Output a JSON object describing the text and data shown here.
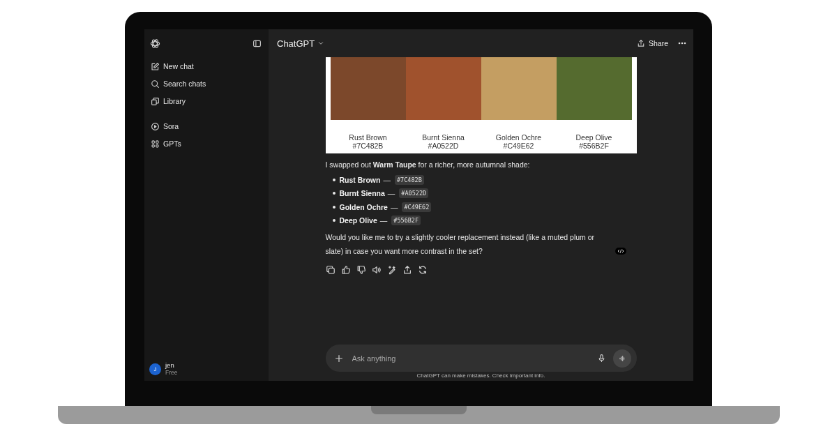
{
  "sidebar": {
    "groups": [
      [
        {
          "label": "New chat"
        },
        {
          "label": "Search chats"
        },
        {
          "label": "Library"
        }
      ],
      [
        {
          "label": "Sora"
        },
        {
          "label": "GPTs"
        }
      ]
    ],
    "user": {
      "initial": "J",
      "name": "jen",
      "plan": "Free"
    }
  },
  "header": {
    "title": "ChatGPT",
    "share": "Share"
  },
  "palette": [
    {
      "name": "Rust Brown",
      "hex": "#7C482B",
      "color": "#7c482b"
    },
    {
      "name": "Burnt Sienna",
      "hex": "#A0522D",
      "color": "#a0522d"
    },
    {
      "name": "Golden Ochre",
      "hex": "#C49E62",
      "color": "#c49e62"
    },
    {
      "name": "Deep Olive",
      "hex": "#556B2F",
      "color": "#556b2f"
    }
  ],
  "message": {
    "intro": "I swapped out **Warm Taupe** for a richer, more autumnal shade:",
    "bullets": [
      {
        "name": "Rust Brown",
        "separator": "—",
        "code": "#7C482B"
      },
      {
        "name": "Burnt Sienna",
        "separator": "—",
        "code": "#A0522D"
      },
      {
        "name": "Golden Ochre",
        "separator": "—",
        "code": "#C49E62"
      },
      {
        "name": "Deep Olive",
        "separator": "—",
        "code": "#556B2F"
      }
    ],
    "followup": "Would you like me to try a slightly cooler replacement instead (like a muted plum or slate) in case you want more contrast in the set?"
  },
  "composer": {
    "placeholder": "Ask anything"
  },
  "footer": "ChatGPT can make mistakes. Check important info."
}
